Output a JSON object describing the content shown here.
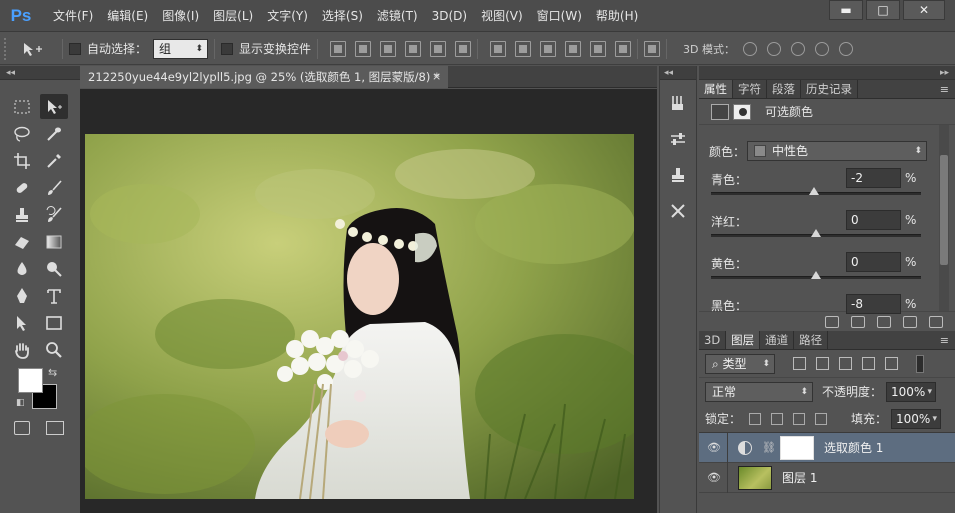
{
  "app": {
    "logo_text": "Ps"
  },
  "menu": [
    "文件(F)",
    "编辑(E)",
    "图像(I)",
    "图层(L)",
    "文字(Y)",
    "选择(S)",
    "滤镜(T)",
    "3D(D)",
    "视图(V)",
    "窗口(W)",
    "帮助(H)"
  ],
  "window_controls": {
    "minimize": "▬",
    "maximize": "□",
    "close": "✕"
  },
  "options_bar": {
    "auto_select_label": "自动选择：",
    "auto_select_value": "组",
    "show_transform_label": "显示变换控件",
    "mode3d_label": "3D 模式："
  },
  "toolbar": {
    "collapse_glyph": "◂◂"
  },
  "document": {
    "tab_title": "212250yue44e9yl2lypll5.jpg @ 25% (选取颜色 1, 图层蒙版/8) *",
    "tab_close": "×"
  },
  "properties_panel": {
    "tabs": [
      "属性",
      "字符",
      "段落",
      "历史记录"
    ],
    "active_tab": 0,
    "title": "可选颜色",
    "color_label": "颜色：",
    "color_value": "中性色",
    "sliders": [
      {
        "label": "青色：",
        "value": "-2",
        "unit": "%",
        "position": 0.49
      },
      {
        "label": "洋红：",
        "value": "0",
        "unit": "%",
        "position": 0.5
      },
      {
        "label": "黄色：",
        "value": "0",
        "unit": "%",
        "position": 0.5
      },
      {
        "label": "黑色：",
        "value": "-8",
        "unit": "%",
        "position": 0.46
      }
    ]
  },
  "layers_panel": {
    "tabs": [
      "3D",
      "图层",
      "通道",
      "路径"
    ],
    "active_tab": 1,
    "kind_value": "类型",
    "blend_value": "正常",
    "opacity_label": "不透明度：",
    "opacity_value": "100%",
    "lock_label": "锁定：",
    "fill_label": "填充：",
    "fill_value": "100%",
    "layers": [
      {
        "name": "选取颜色 1",
        "selected": true
      },
      {
        "name": "图层 1",
        "selected": false
      }
    ]
  },
  "colors": {
    "foreground": "#ffffff",
    "background": "#000000",
    "accent": "#4aa0ff",
    "selection": "#5d6d80"
  }
}
